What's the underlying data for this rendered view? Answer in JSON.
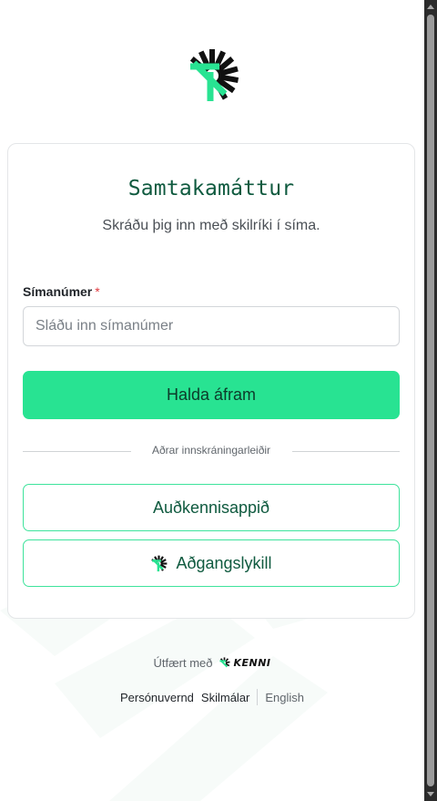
{
  "brand": {
    "logo_icon": "kenni-burst-logo-icon",
    "accent_color": "#28e392",
    "dark_green": "#0f5a3f"
  },
  "card": {
    "title": "Samtakamáttur",
    "subtitle": "Skráðu þig inn með skilríki í síma."
  },
  "phone_field": {
    "label": "Símanúmer",
    "required_marker": "*",
    "value": "",
    "placeholder": "Sláðu inn símanúmer"
  },
  "primary_button": {
    "label": "Halda áfram"
  },
  "divider": {
    "label": "Aðrar innskráningarleiðir"
  },
  "alt_methods": {
    "app_label": "Auðkennisappið",
    "passkey_label": "Aðgangslykill",
    "passkey_icon": "kenni-burst-icon"
  },
  "footer": {
    "powered_by": "Útfært með",
    "powered_brand": "KENNI",
    "links": {
      "privacy": "Persónuvernd",
      "terms": "Skilmálar",
      "language": "English"
    }
  }
}
